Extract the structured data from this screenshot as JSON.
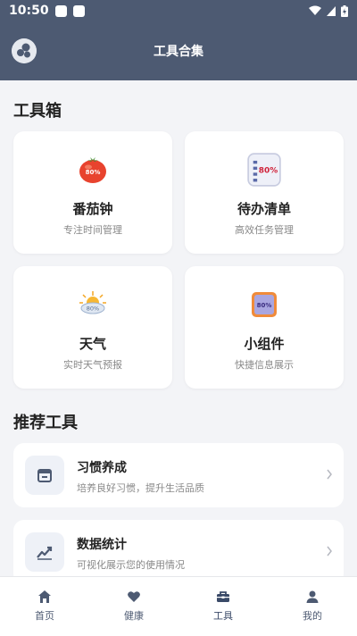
{
  "status_bar": {
    "time": "10:50"
  },
  "app_bar": {
    "title": "工具合集"
  },
  "toolbox": {
    "title": "工具箱",
    "items": [
      {
        "name": "番茄钟",
        "desc": "专注时间管理",
        "badge": "80%",
        "icon": "tomato-icon"
      },
      {
        "name": "待办清单",
        "desc": "高效任务管理",
        "badge": "80%",
        "icon": "checklist-icon"
      },
      {
        "name": "天气",
        "desc": "实时天气预报",
        "badge": "80%",
        "icon": "weather-icon"
      },
      {
        "name": "小组件",
        "desc": "快捷信息展示",
        "badge": "80%",
        "icon": "widget-icon"
      }
    ]
  },
  "recommended": {
    "title": "推荐工具",
    "items": [
      {
        "name": "习惯养成",
        "desc": "培养良好习惯，提升生活品质",
        "icon": "calendar-icon"
      },
      {
        "name": "数据统计",
        "desc": "可视化展示您的使用情况",
        "icon": "chart-trend-icon"
      }
    ]
  },
  "tabs": [
    {
      "label": "首页",
      "icon": "home-icon"
    },
    {
      "label": "健康",
      "icon": "heart-icon"
    },
    {
      "label": "工具",
      "icon": "toolbox-icon",
      "active": true
    },
    {
      "label": "我的",
      "icon": "person-icon"
    }
  ],
  "colors": {
    "primary": "#4d5a72",
    "background": "#f3f4f7",
    "card": "#ffffff"
  }
}
